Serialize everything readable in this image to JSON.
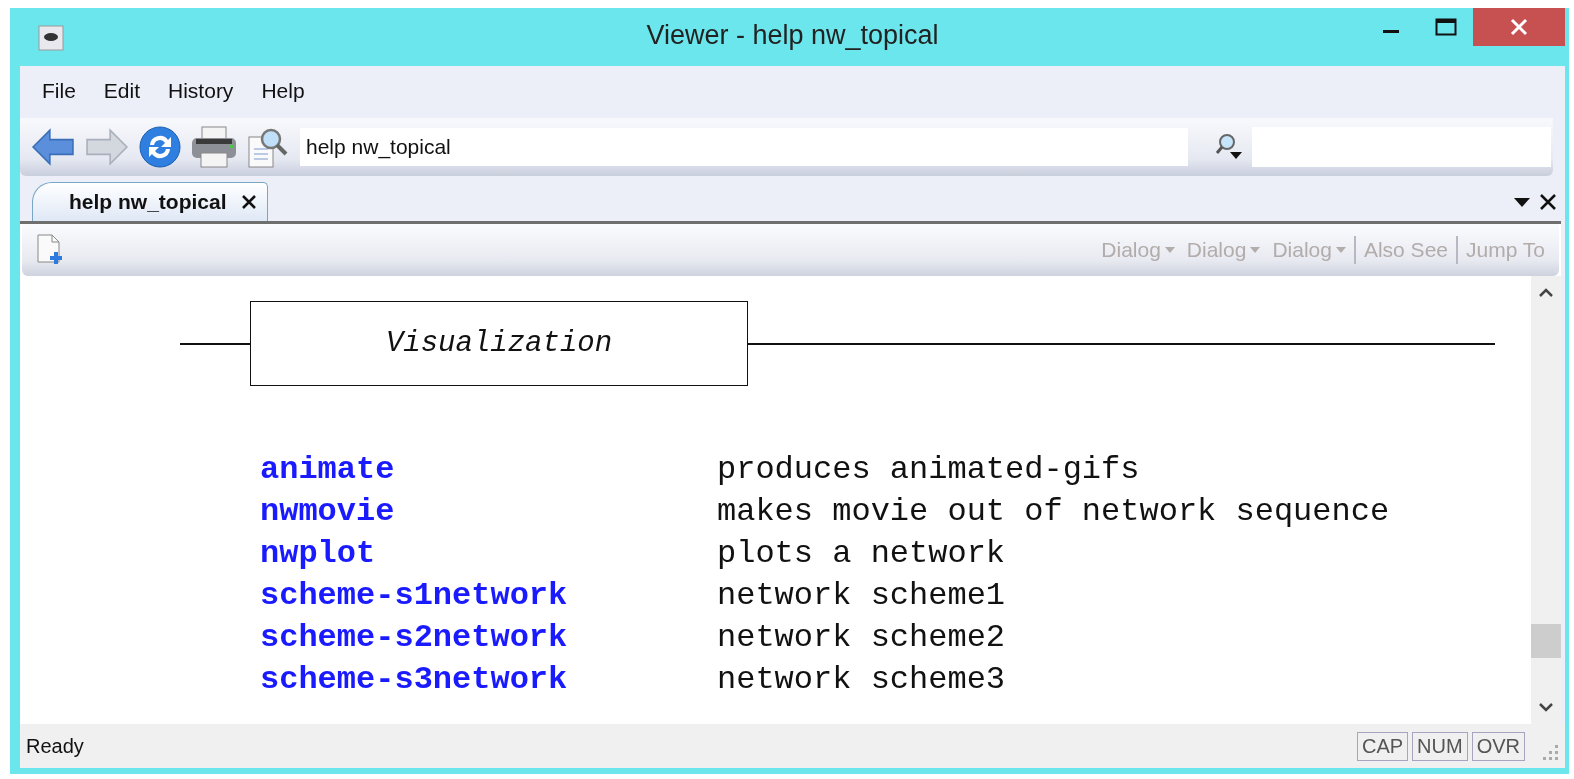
{
  "window": {
    "title": "Viewer - help nw_topical"
  },
  "menu": [
    "File",
    "Edit",
    "History",
    "Help"
  ],
  "toolbar": {
    "address": "help nw_topical"
  },
  "tabs": [
    {
      "label": "help nw_topical",
      "selected": true
    }
  ],
  "content_toolbar": [
    {
      "label": "Dialog",
      "kind": "dropdown",
      "disabled": true
    },
    {
      "label": "Dialog",
      "kind": "dropdown",
      "disabled": true
    },
    {
      "label": "Dialog",
      "kind": "dropdown",
      "disabled": true
    },
    {
      "label": "Also See",
      "kind": "link",
      "disabled": true
    },
    {
      "label": "Jump To",
      "kind": "link",
      "disabled": true
    }
  ],
  "document": {
    "heading": "Visualization",
    "entries": [
      {
        "command": "animate",
        "description": "produces animated-gifs"
      },
      {
        "command": "nwmovie",
        "description": "makes movie out of network sequence"
      },
      {
        "command": "nwplot",
        "description": "plots a network"
      },
      {
        "command": "scheme-s1network",
        "description": "network scheme1"
      },
      {
        "command": "scheme-s2network",
        "description": "network scheme2"
      },
      {
        "command": "scheme-s3network",
        "description": "network scheme3"
      }
    ]
  },
  "status_bar": {
    "text": "Ready",
    "indicators": [
      "CAP",
      "NUM",
      "OVR"
    ]
  }
}
